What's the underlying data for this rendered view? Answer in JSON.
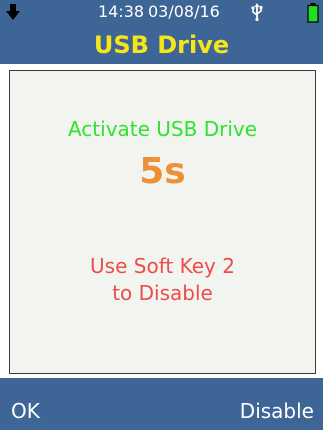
{
  "status_bar": {
    "time": "14:38",
    "date": "03/08/16",
    "icons": [
      "down-arrow-icon",
      "usb-icon",
      "battery-icon"
    ],
    "battery_color": "#22dd22"
  },
  "header": {
    "title": "USB Drive",
    "title_color": "#f5e51a",
    "background": "#3d6595"
  },
  "panel": {
    "message": "Activate USB Drive",
    "countdown": "5s",
    "instruction_line1": "Use Soft Key 2",
    "instruction_line2": "to Disable",
    "message_color": "#33e033",
    "countdown_color": "#ef8f36",
    "instruction_color": "#ee4c4c"
  },
  "softkeys": {
    "key1_label": "OK",
    "key2_label": "Disable"
  }
}
